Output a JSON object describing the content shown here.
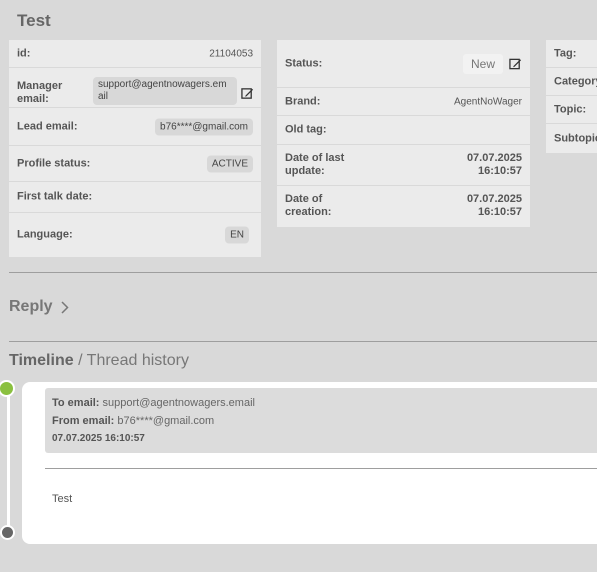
{
  "page_title": "Test",
  "left_card": {
    "id_label": "id:",
    "id_value": "21104053",
    "manager_label": "Manager email:",
    "manager_value": "support@agentnowagers.email",
    "lead_label": "Lead email:",
    "lead_value": "b76****@gmail.com",
    "profile_label": "Profile status:",
    "profile_value": "ACTIVE",
    "first_talk_label": "First talk date:",
    "first_talk_value": "",
    "language_label": "Language:",
    "language_value": "EN"
  },
  "middle_card": {
    "status_label": "Status:",
    "status_value": "New",
    "brand_label": "Brand:",
    "brand_value": "AgentNoWager",
    "oldtag_label": "Old tag:",
    "oldtag_value": "",
    "last_update_label": "Date of last update:",
    "last_update_date": "07.07.2025",
    "last_update_time": "16:10:57",
    "creation_label": "Date of creation:",
    "creation_date": "07.07.2025",
    "creation_time": "16:10:57"
  },
  "right_card": {
    "tag_label": "Tag:",
    "category_label": "Category:",
    "topic_label": "Topic:",
    "subtopic_label": "Subtopic:"
  },
  "reply": {
    "label": "Reply"
  },
  "timeline": {
    "title": "Timeline",
    "subtitle": "/ Thread history",
    "message": {
      "to_label": "To email:",
      "to_value": "support@agentnowagers.email",
      "from_label": "From email:",
      "from_value": "b76****@gmail.com",
      "date": "07.07.2025 16:10:57",
      "body": "Test"
    }
  },
  "colors": {
    "timeline_start": "#8ac03f",
    "timeline_end": "#666666"
  },
  "icons": [
    "edit-icon",
    "chevron-right-icon"
  ]
}
